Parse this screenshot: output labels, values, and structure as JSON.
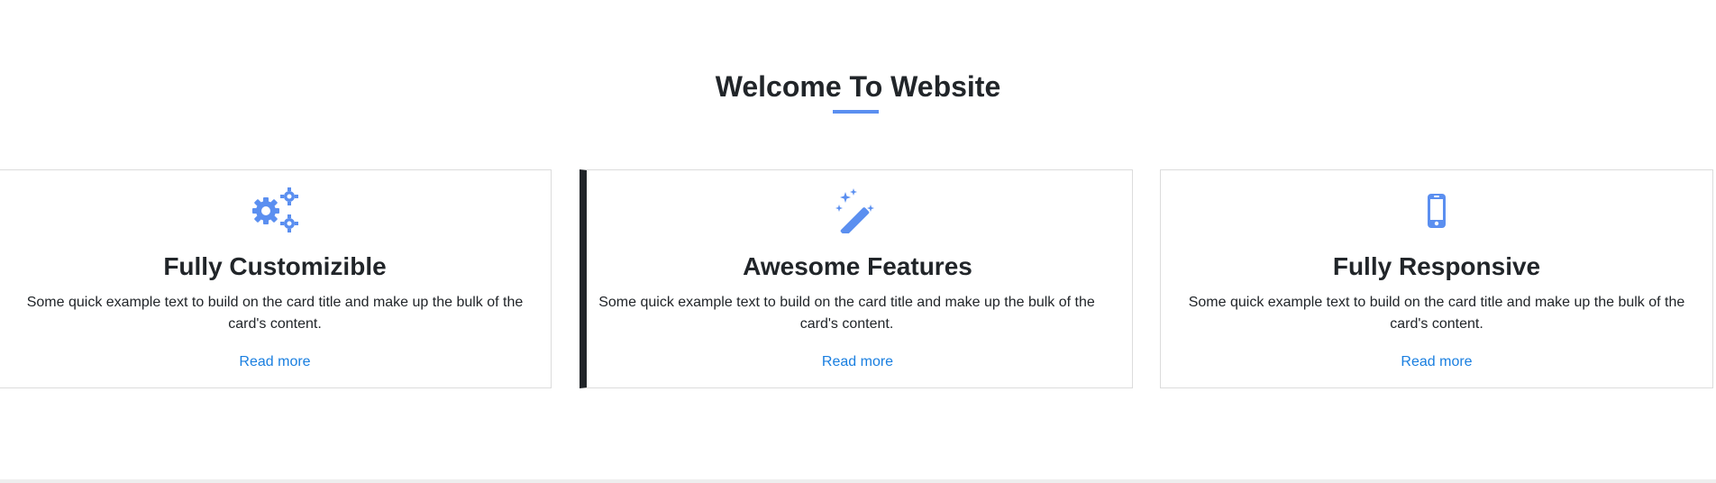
{
  "section": {
    "title": "Welcome To Website",
    "accent_color": "#5b8ff0"
  },
  "cards": [
    {
      "icon": "gears-icon",
      "title": "Fully Customizible",
      "text": "Some quick example text to build on the card title and make up the bulk of the card's content.",
      "link_label": "Read more"
    },
    {
      "icon": "magic-wand-icon",
      "title": "Awesome Features",
      "text": "Some quick example text to build on the card title and make up the bulk of the card's content.",
      "link_label": "Read more"
    },
    {
      "icon": "mobile-phone-icon",
      "title": "Fully Responsive",
      "text": "Some quick example text to build on the card title and make up the bulk of the card's content.",
      "link_label": "Read more"
    }
  ],
  "colors": {
    "icon": "#5b8ff0",
    "link": "#1a7fe0",
    "text": "#212529",
    "card_border": "#dcdcdc",
    "active_card_border": "#212529"
  }
}
